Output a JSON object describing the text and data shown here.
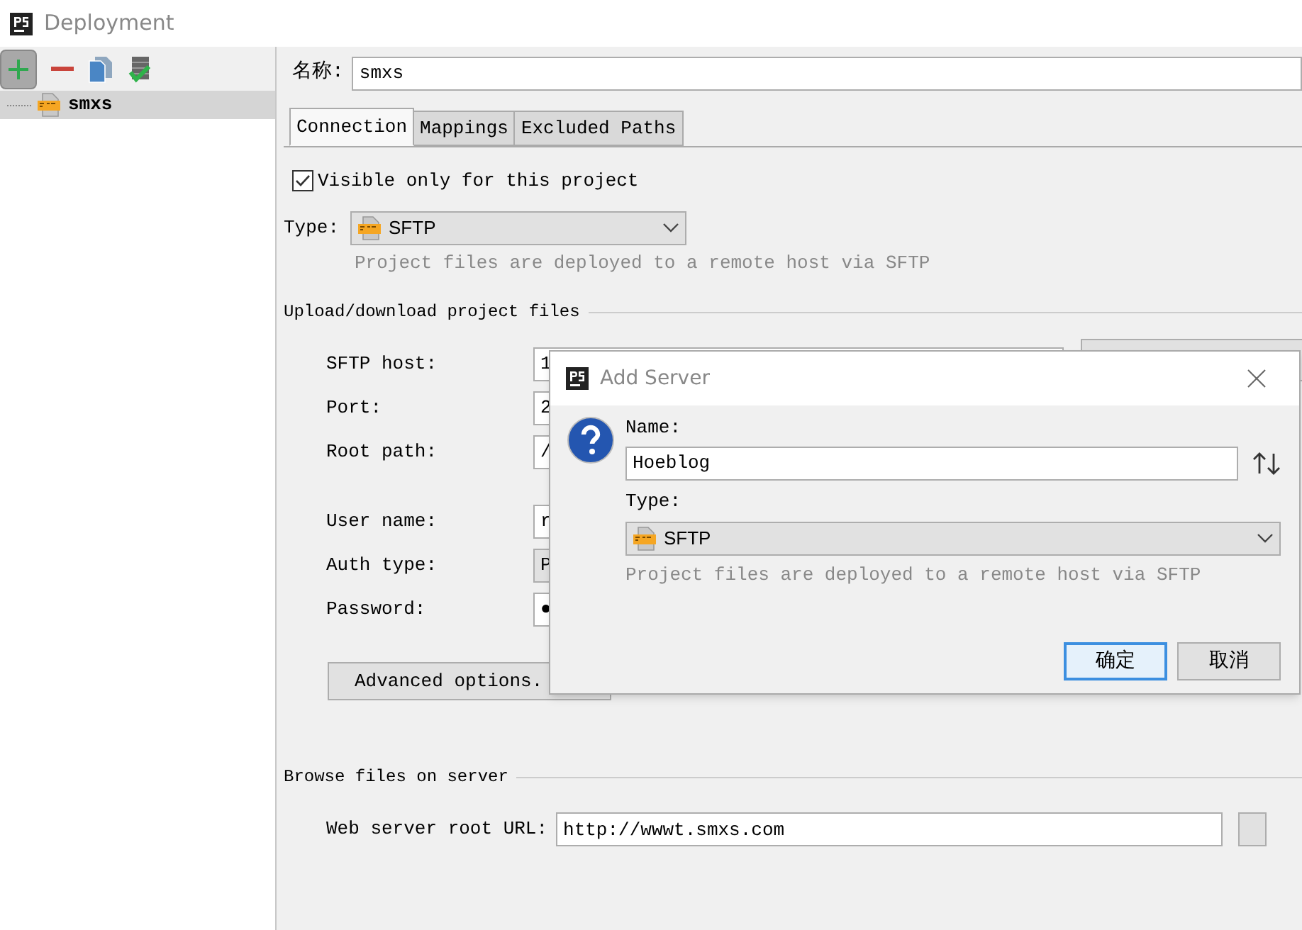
{
  "window": {
    "title": "Deployment"
  },
  "tree": [
    {
      "label": "smxs",
      "selected": true
    }
  ],
  "name_field": {
    "label": "名称:",
    "value": "smxs"
  },
  "tabs": [
    {
      "label": "Connection",
      "selected": true
    },
    {
      "label": "Mappings",
      "selected": false
    },
    {
      "label": "Excluded Paths",
      "selected": false
    }
  ],
  "visible_only": {
    "label": "Visible only for this project",
    "checked": true
  },
  "type": {
    "label": "Type:",
    "value": "SFTP",
    "description": "Project files are deployed to a remote host via SFTP"
  },
  "upload": {
    "title": "Upload/download project files",
    "groups": [
      [
        {
          "label": "SFTP host:",
          "value": "1",
          "kind": "text"
        },
        {
          "label": "Port:",
          "value": "2",
          "kind": "text"
        },
        {
          "label": "Root path:",
          "value": "/",
          "kind": "text"
        }
      ],
      [
        {
          "label": "User name:",
          "value": "r",
          "kind": "text"
        },
        {
          "label": "Auth type:",
          "value": "P",
          "kind": "dropdown"
        },
        {
          "label": "Password:",
          "value": "●",
          "kind": "text"
        }
      ]
    ],
    "advanced_button": "Advanced options."
  },
  "browse": {
    "title": "Browse files on server",
    "url_label": "Web server root URL:",
    "url": "http://wwwt.smxs.com"
  },
  "dialog": {
    "title": "Add Server",
    "name_label": "Name:",
    "name": "Hoeblog",
    "type_label": "Type:",
    "type": "SFTP",
    "description": "Project files are deployed to a remote host via SFTP",
    "buttons": [
      {
        "label": "确定",
        "selected": true
      },
      {
        "label": "取消",
        "selected": false
      }
    ]
  }
}
